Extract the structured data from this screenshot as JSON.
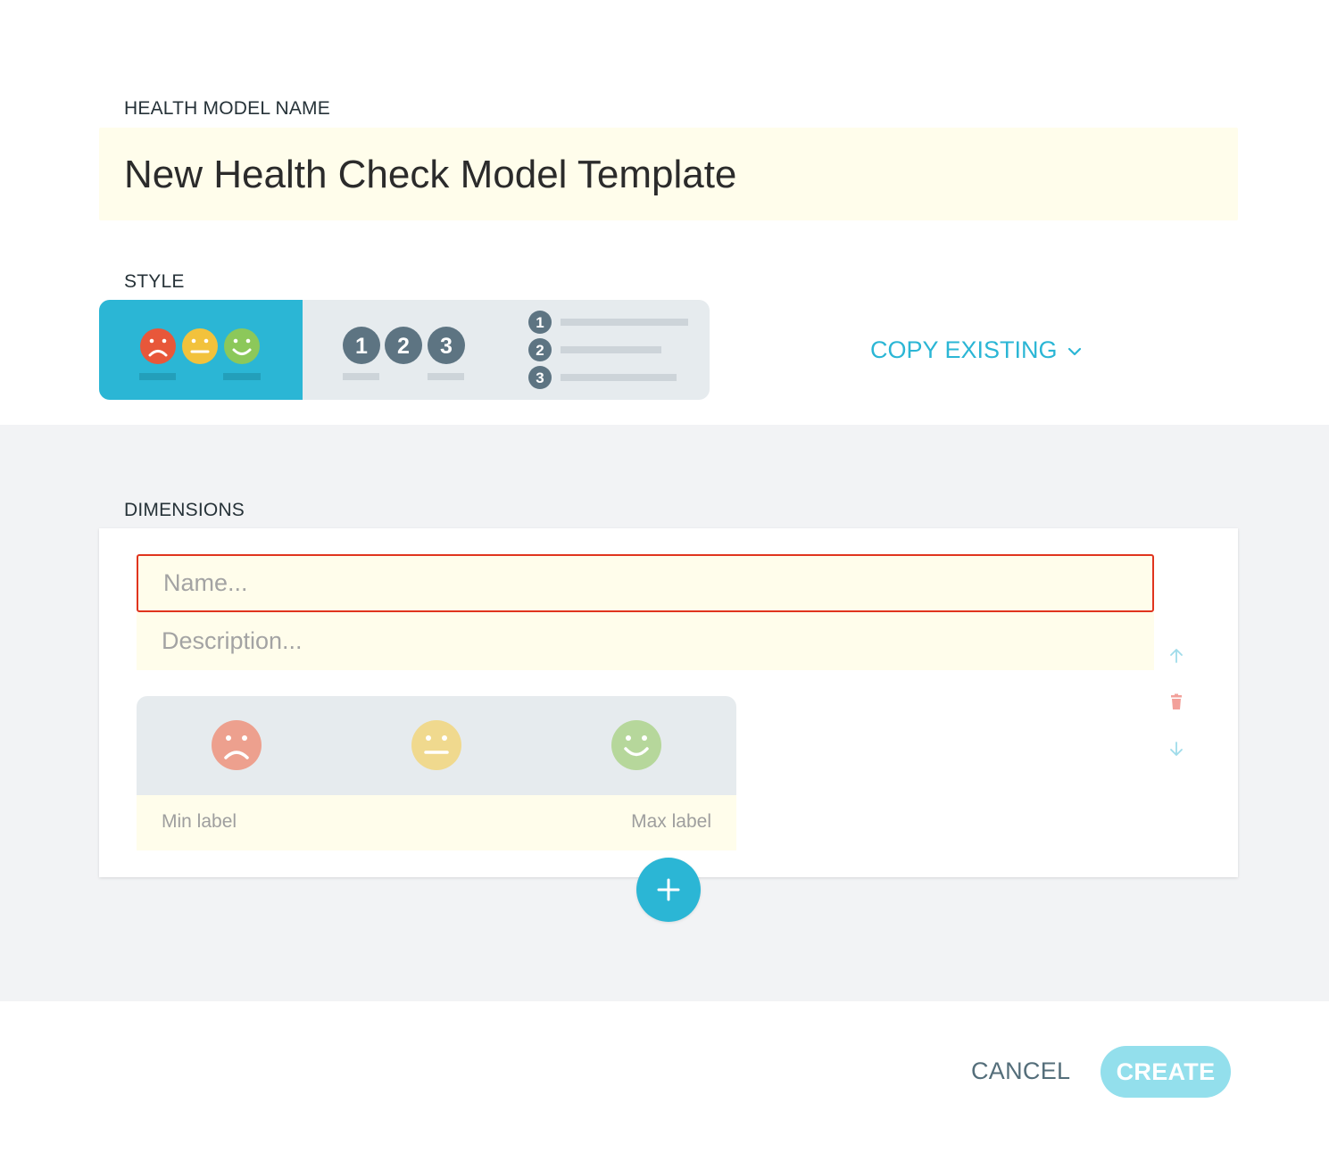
{
  "health_model_name": {
    "label": "HEALTH MODEL NAME",
    "value": "New Health Check Model Template"
  },
  "style": {
    "label": "STYLE",
    "options": [
      {
        "type": "smileys",
        "selected": true
      },
      {
        "type": "numbers",
        "numbers": [
          "1",
          "2",
          "3"
        ],
        "selected": false
      },
      {
        "type": "numbered-list",
        "numbers": [
          "1",
          "2",
          "3"
        ],
        "selected": false
      }
    ],
    "copy_existing_label": "COPY EXISTING"
  },
  "dimensions": {
    "label": "DIMENSIONS",
    "items": [
      {
        "name_placeholder": "Name...",
        "description_placeholder": "Description...",
        "min_label": "Min label",
        "max_label": "Max label",
        "faces": [
          "sad-face-icon",
          "neutral-face-icon",
          "happy-face-icon"
        ]
      }
    ]
  },
  "footer": {
    "cancel_label": "CANCEL",
    "create_label": "CREATE"
  },
  "colors": {
    "accent": "#2bb6d5",
    "error_border": "#e0341e",
    "input_bg": "#fffdeb",
    "sad": "#e8573a",
    "neutral": "#f2c23c",
    "happy": "#8cc85a"
  }
}
